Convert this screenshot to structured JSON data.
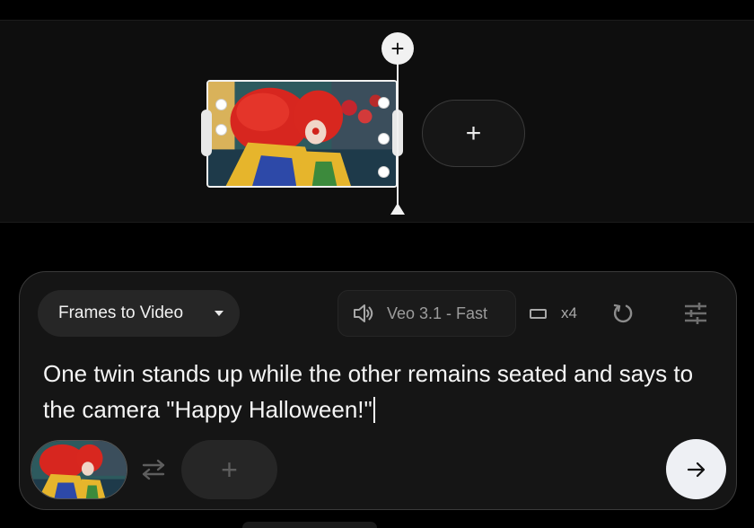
{
  "timeline": {
    "playhead_add_label": "+",
    "add_clip_label": "+"
  },
  "prompt_panel": {
    "mode": "Frames to Video",
    "model": "Veo 3.1 - Fast",
    "output_count": "x4",
    "prompt_text": "One twin stands up while the other remains seated and says to the camera \"Happy Halloween!\"",
    "add_end_frame_label": "+"
  },
  "icons": {
    "playhead": "plus-icon",
    "add_clip": "plus-icon",
    "mode_caret": "caret-down-icon",
    "model": "volume-icon",
    "aspect": "aspect-ratio-icon",
    "refresh": "refresh-icon",
    "settings": "tune-icon",
    "swap": "swap-icon",
    "send": "arrow-right-icon"
  },
  "colors": {
    "background": "#000000",
    "panel": "#151515",
    "chip": "#262626",
    "send_button": "#eef0f4",
    "text_primary": "#f5f5f5",
    "text_muted": "#9c9c9c"
  }
}
